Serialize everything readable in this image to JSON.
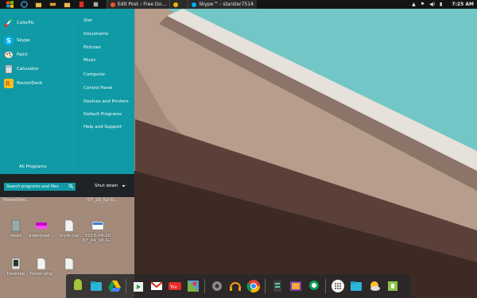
{
  "topbar": {
    "tabs": [
      {
        "label": "Edit Post ‹ Free Do…",
        "color": "#e8552a"
      },
      {
        "label": "",
        "color": "#f4b400"
      },
      {
        "label": "Skype™ - starstar7514",
        "color": "#00aff0"
      }
    ],
    "clock": "7:25 AM"
  },
  "startmenu": {
    "programs": [
      {
        "label": "ColorPic",
        "icon": "colorpic-icon"
      },
      {
        "label": "Skype",
        "icon": "skype-icon"
      },
      {
        "label": "Paint",
        "icon": "paint-icon"
      },
      {
        "label": "Calculator",
        "icon": "calculator-icon"
      },
      {
        "label": "RocketDock",
        "icon": "rocketdock-icon"
      }
    ],
    "places": [
      "Star",
      "Documents",
      "Pictures",
      "Music",
      "Computer",
      "Control Panel",
      "Devices and Printers",
      "Default Programs",
      "Help and Support"
    ],
    "all_programs": "All Programs",
    "search_placeholder": "Search programs and files",
    "shutdown": "Shut down",
    "accent": "#0f9aa5"
  },
  "desktop": {
    "partial_labels": [
      "PowerDire…",
      "07_23_52-G…"
    ],
    "icons": [
      {
        "label": "dead"
      },
      {
        "label": "download…"
      },
      {
        "label": "style.css"
      },
      {
        "label": "2015-09-20 07_24_18-G…"
      },
      {
        "label": "Desktop"
      },
      {
        "label": "footer.php"
      },
      {
        "label": "c"
      }
    ]
  },
  "dock": {
    "icons": [
      "android-icon",
      "folder-icon",
      "drive-icon",
      "play-store-icon",
      "gmail-icon",
      "youtube-icon",
      "maps-icon",
      "settings-icon",
      "headphones-icon",
      "chrome-icon",
      "calculator-icon",
      "photos-icon",
      "hangouts-icon",
      "apps-icon",
      "files-icon",
      "weather-icon",
      "apk-icon"
    ]
  }
}
